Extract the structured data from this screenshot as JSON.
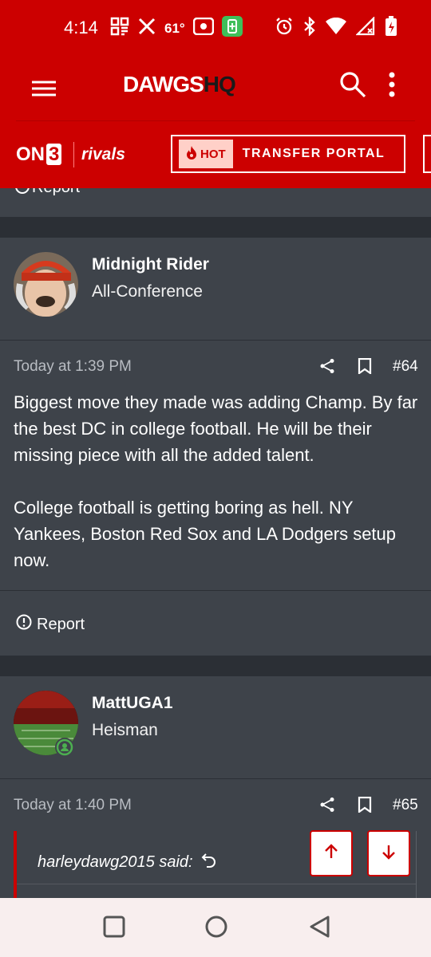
{
  "status_bar": {
    "time": "4:14",
    "temperature": "61°",
    "icons_left": [
      "grid-icon",
      "x-logo-icon",
      "temperature-text",
      "record-icon",
      "battery-saver-icon"
    ],
    "icons_right": [
      "alarm-icon",
      "bluetooth-icon",
      "wifi-icon",
      "signal-icon",
      "battery-charging-icon"
    ]
  },
  "app_bar": {
    "logo_part1": "DAWGS",
    "logo_part2": "HQ"
  },
  "sub_bar": {
    "on3_label": "ON",
    "on3_digit": "3",
    "rivals_label": "rivals",
    "hot_label": "HOT",
    "portal_label": "TRANSFER PORTAL"
  },
  "prev_post": {
    "report_label": "Report"
  },
  "posts": [
    {
      "username": "Midnight Rider",
      "user_title": "All-Conference",
      "date": "Today at 1:39 PM",
      "number": "#64",
      "paragraphs": [
        "Biggest move they made was adding Champ. By far the best DC in college football. He will be their missing piece with all the added talent.",
        "College football is getting boring as hell. NY Yankees, Boston Red Sox and LA Dodgers setup now."
      ],
      "report_label": "Report"
    },
    {
      "username": "MattUGA1",
      "user_title": "Heisman",
      "date": "Today at 1:40 PM",
      "number": "#65",
      "quote_author": "harleydawg2015 said:"
    }
  ],
  "colors": {
    "brand_red": "#cc0000",
    "card_bg": "#3e434a",
    "page_bg": "#2b2f35",
    "online_green": "#4caf50"
  },
  "nav_bar": {
    "buttons": [
      "recents-square-icon",
      "home-circle-icon",
      "back-triangle-icon"
    ]
  }
}
